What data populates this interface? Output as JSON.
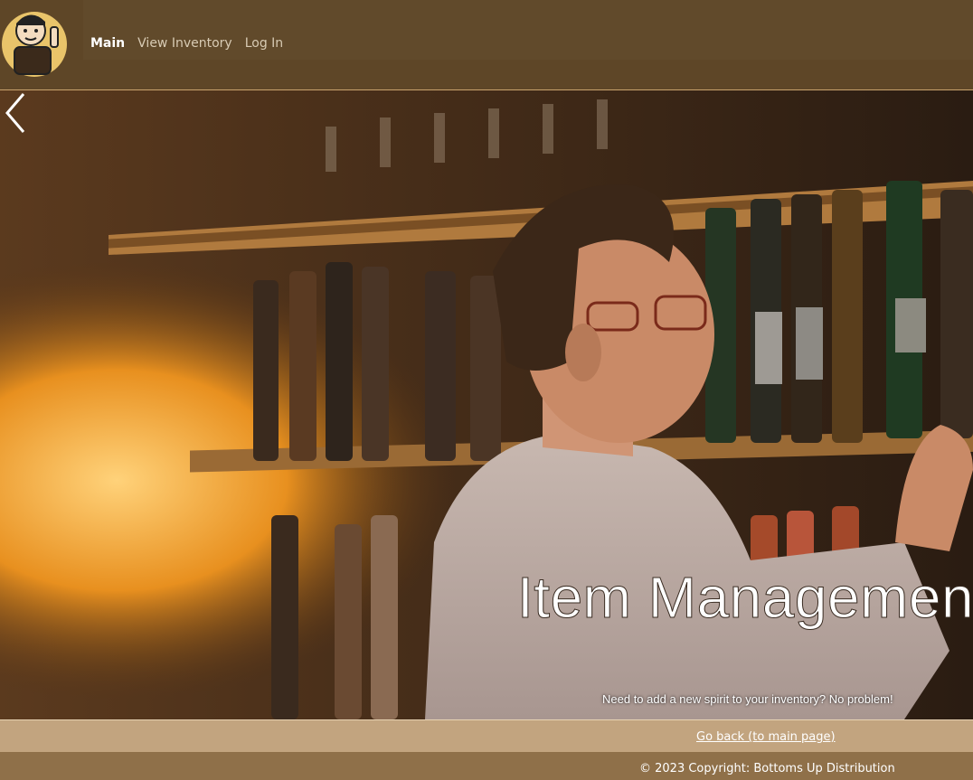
{
  "nav": {
    "logo_icon": "mascot-logo-icon",
    "links": [
      {
        "label": "Main",
        "active": true
      },
      {
        "label": "View Inventory",
        "active": false
      },
      {
        "label": "Log In",
        "active": false
      }
    ]
  },
  "hero": {
    "title": "Item Managemen",
    "caption": "Need to add a new spirit to your inventory? No problem!",
    "prev_icon": "chevron-left-icon"
  },
  "back_link": "Go back (to main page)",
  "footer": "© 2023 Copyright: Bottoms Up Distribution",
  "colors": {
    "navbar": "#5e4627",
    "backbar": "#c2a47f",
    "footer": "#8f7049"
  }
}
